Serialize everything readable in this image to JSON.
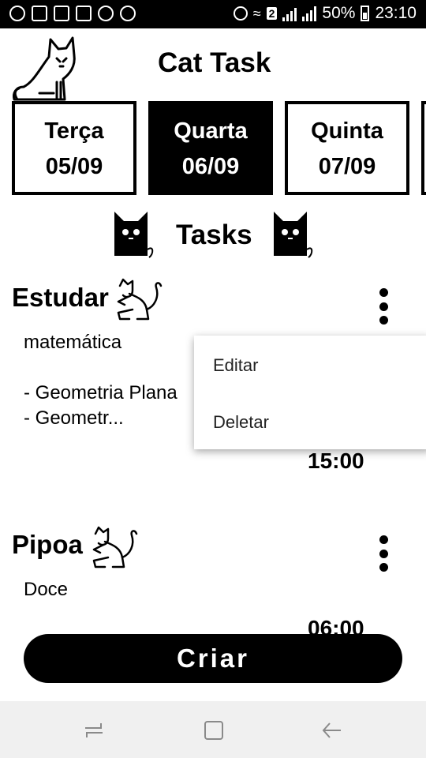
{
  "status_bar": {
    "sim_badge": "2",
    "battery": "50%",
    "time": "23:10"
  },
  "header": {
    "title": "Cat Task",
    "logo_icon": "cat-sitting-icon"
  },
  "days": [
    {
      "name": "Terça",
      "date": "05/09",
      "selected": false
    },
    {
      "name": "Quarta",
      "date": "06/09",
      "selected": true
    },
    {
      "name": "Quinta",
      "date": "07/09",
      "selected": false
    }
  ],
  "tasks_heading": "Tasks",
  "tasks": [
    {
      "title": "Estudar",
      "description": "matemática\n\n- Geometria Plana\n- Geometr...",
      "time": "15:00"
    },
    {
      "title": "Pipoa",
      "description": "Doce",
      "time": "06:00"
    }
  ],
  "menu": {
    "edit": "Editar",
    "delete": "Deletar"
  },
  "create_button": "Criar",
  "colors": {
    "primary": "#000000",
    "background": "#ffffff",
    "navbar": "#f0f0f0"
  }
}
